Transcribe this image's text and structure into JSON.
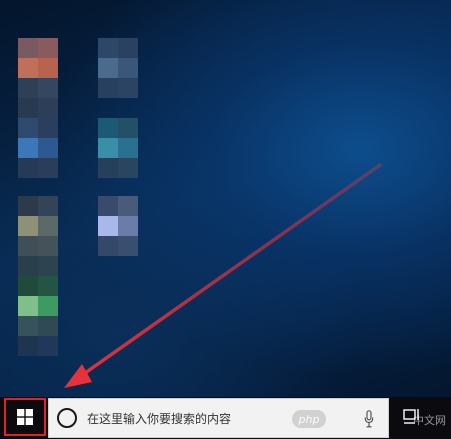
{
  "taskbar": {
    "search_placeholder": "在这里输入你要搜索的内容",
    "icons": {
      "start": "windows-logo-icon",
      "search": "cortana-circle-icon",
      "microphone": "microphone-icon",
      "task_view": "task-view-icon"
    }
  },
  "watermark": {
    "logo_text": "php",
    "site_text": "中文网"
  },
  "colors": {
    "highlight_border": "#e0202a",
    "arrow": "#e8323a",
    "taskbar": "#0a0a0f",
    "search_box": "#f2f2f2"
  }
}
